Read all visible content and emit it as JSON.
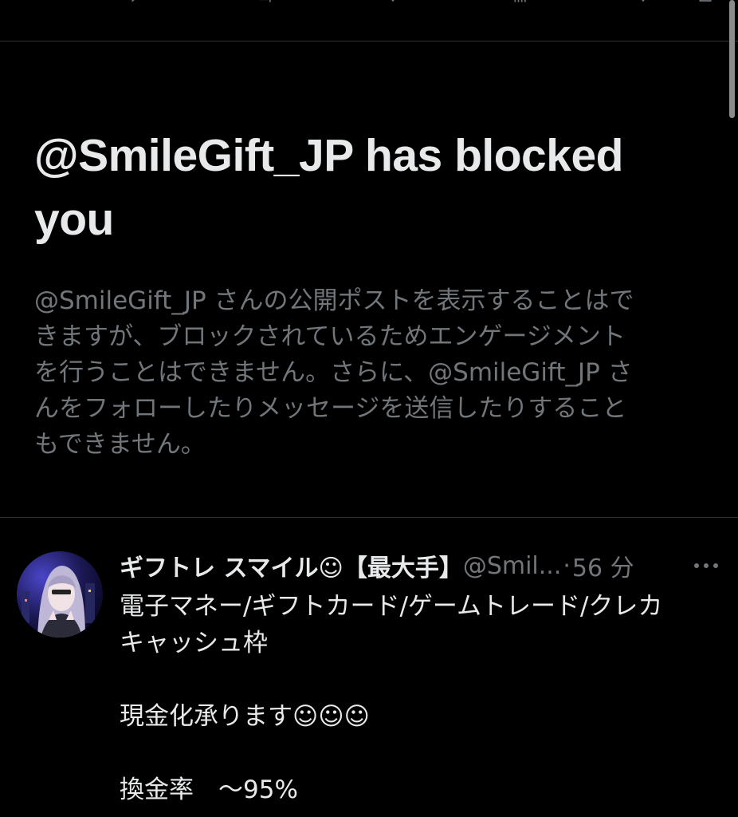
{
  "blocked": {
    "title": "@SmileGift_JP has blocked you",
    "description_lines": [
      "@SmileGift_JP さんの公開ポストを表示することはで",
      "きますが、ブロックされているためエンゲージメント",
      "を行うことはできません。さらに、@SmileGift_JP さ",
      "んをフォローしたりメッセージを送信したりすること",
      "もできません。"
    ]
  },
  "post": {
    "display_name": "ギフトレ スマイル☺【最大手】",
    "handle": "@Smil...",
    "separator": "·",
    "time": "56 分",
    "body_lines": [
      "電子マネー/ギフトカード/ゲームトレード/クレカ",
      "キャッシュ枠",
      "",
      "現金化承ります☺☺☺",
      "",
      "換金率　～95%"
    ]
  },
  "colors": {
    "background": "#000000",
    "primary_text": "#e7e9ea",
    "secondary_text": "#71767b",
    "divider": "#2f3336"
  },
  "icons": {
    "top_bar": [
      "reply-icon",
      "repost-icon",
      "like-icon",
      "views-icon",
      "bookmark-icon",
      "share-icon"
    ],
    "post": [
      "more-icon"
    ]
  }
}
